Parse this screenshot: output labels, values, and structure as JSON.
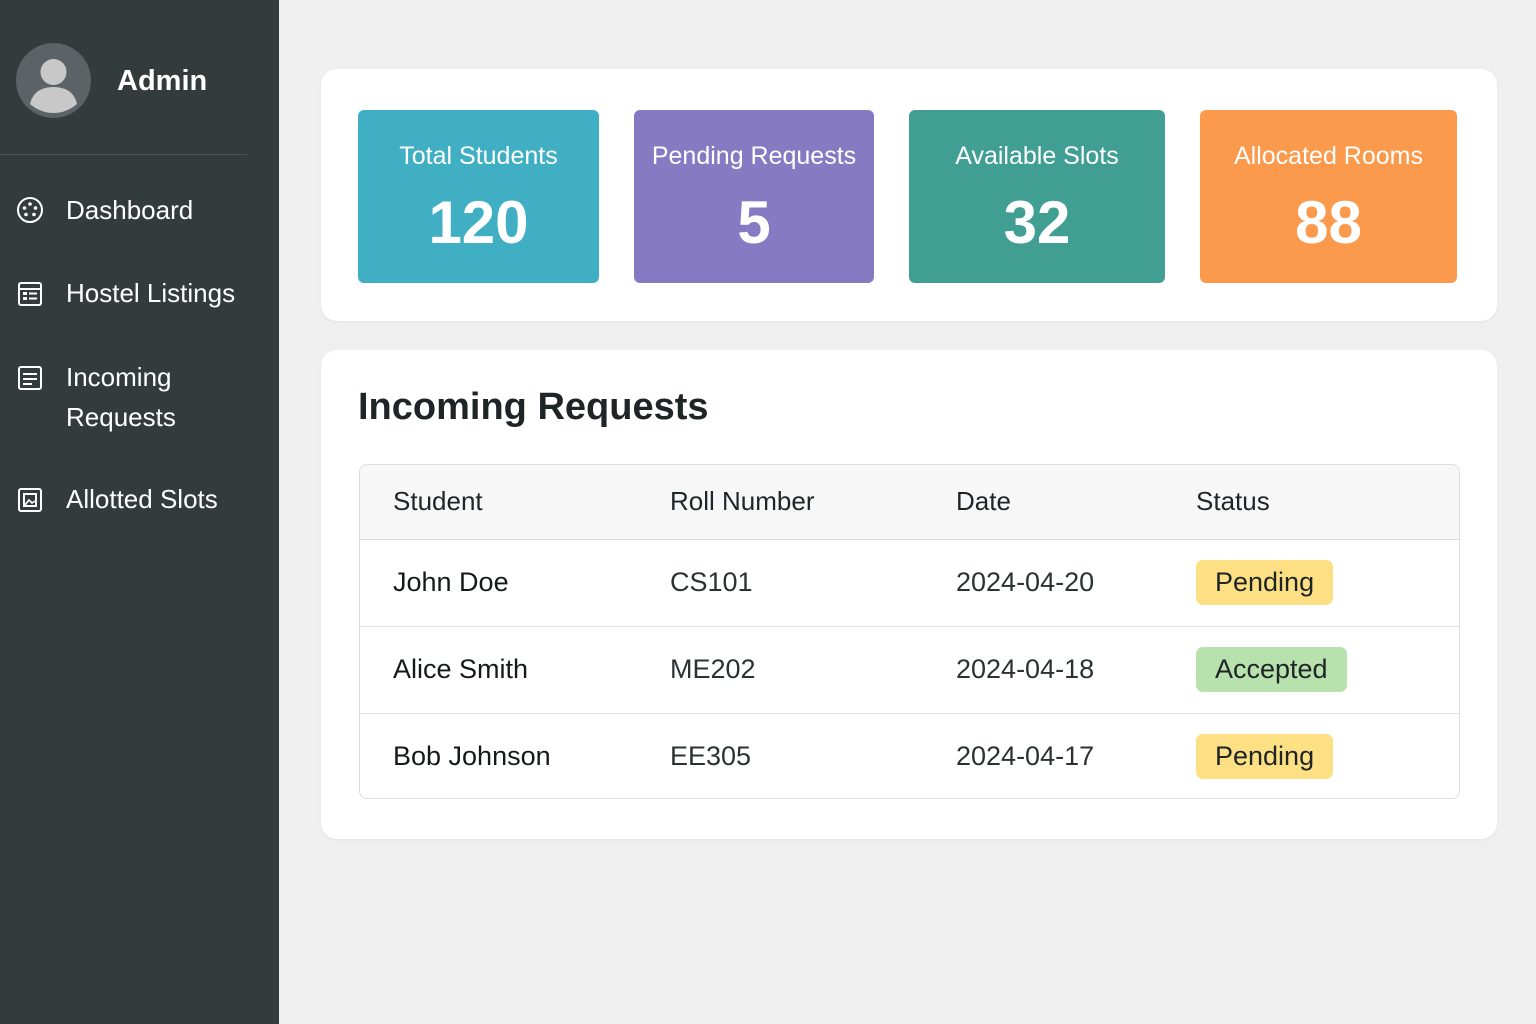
{
  "sidebar": {
    "user_name": "Admin",
    "items": [
      {
        "label": "Dashboard",
        "icon": "dashboard-icon"
      },
      {
        "label": "Hostel Listings",
        "icon": "list-icon"
      },
      {
        "label": "Incoming Requests",
        "label_line1": "Incoming",
        "label_line2": "Requests",
        "icon": "document-icon"
      },
      {
        "label": "Allotted Slots",
        "icon": "image-icon"
      }
    ]
  },
  "stats": [
    {
      "label": "Total Students",
      "value": "120",
      "color": "#40afc4"
    },
    {
      "label": "Pending Requests",
      "value": "5",
      "color": "#867ac2"
    },
    {
      "label": "Available Slots",
      "value": "32",
      "color": "#409e93"
    },
    {
      "label": "Allocated Rooms",
      "value": "88",
      "color": "#fb9a4c"
    }
  ],
  "requests": {
    "title": "Incoming Requests",
    "columns": [
      "Student",
      "Roll Number",
      "Date",
      "Status"
    ],
    "rows": [
      {
        "student": "John Doe",
        "roll": "CS101",
        "date": "2024-04-20",
        "status": "Pending"
      },
      {
        "student": "Alice Smith",
        "roll": "ME202",
        "date": "2024-04-18",
        "status": "Accepted"
      },
      {
        "student": "Bob Johnson",
        "roll": "EE305",
        "date": "2024-04-17",
        "status": "Pending"
      }
    ]
  },
  "colors": {
    "sidebar_bg": "#343b3d",
    "page_bg": "#efefef",
    "pending_badge": "#fde083",
    "accepted_badge": "#b7e2ad"
  }
}
